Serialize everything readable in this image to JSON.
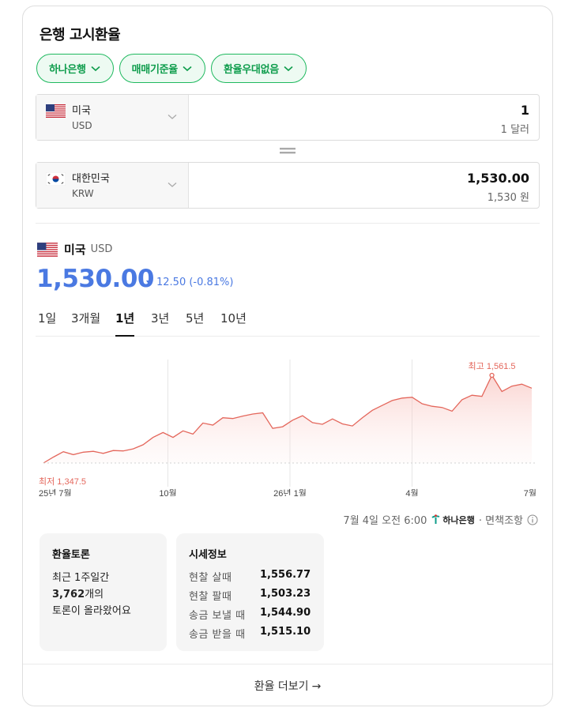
{
  "title": "은행 고시환율",
  "filters": [
    "하나은행",
    "매매기준율",
    "환율우대없음"
  ],
  "from": {
    "country": "미국",
    "code": "USD",
    "amount": "1",
    "amount_text": "1 달러"
  },
  "to": {
    "country": "대한민국",
    "code": "KRW",
    "amount": "1,530.00",
    "amount_text": "1,530 원"
  },
  "rate": {
    "country": "미국",
    "code": "USD",
    "value": "1,530.00",
    "change": "12.50 (-0.81%)"
  },
  "periods": [
    "1일",
    "3개월",
    "1년",
    "3년",
    "5년",
    "10년"
  ],
  "active_period": "1년",
  "chart_data": {
    "type": "area",
    "x_ticks": [
      "25년 7월",
      "10월",
      "26년 1월",
      "4월",
      "7월"
    ],
    "values": [
      1347.5,
      1362,
      1375,
      1368,
      1374,
      1376,
      1371,
      1378,
      1377,
      1382,
      1392,
      1410,
      1422,
      1410,
      1426,
      1418,
      1445,
      1440,
      1458,
      1456,
      1462,
      1467,
      1470,
      1432,
      1436,
      1452,
      1463,
      1446,
      1442,
      1455,
      1443,
      1438,
      1458,
      1476,
      1488,
      1500,
      1506,
      1508,
      1492,
      1486,
      1483,
      1474,
      1502,
      1513,
      1510,
      1561.5,
      1522,
      1535,
      1540,
      1530
    ],
    "max": {
      "label": "최고",
      "value": "1,561.5"
    },
    "min": {
      "label": "최저",
      "value": "1,347.5"
    },
    "line_color": "#e4675c"
  },
  "source": {
    "timestamp": "7월 4일 오전 6:00",
    "bank": "하나은행",
    "disclaimer": "· 면책조항"
  },
  "forum": {
    "title": "환율토론",
    "line1": "최근 1주일간",
    "count": "3,762",
    "count_suffix": "개의",
    "line3": "토론이 올라왔어요"
  },
  "quotes": {
    "title": "시세정보",
    "rows": [
      {
        "label": "현찰 살때",
        "value": "1,556.77"
      },
      {
        "label": "현찰 팔때",
        "value": "1,503.23"
      },
      {
        "label": "송금 보낼 때",
        "value": "1,544.90"
      },
      {
        "label": "송금 받을 때",
        "value": "1,515.10"
      }
    ]
  },
  "more_label": "환율 더보기",
  "colors": {
    "accent_green": "#1fb95f",
    "rate_blue": "#4a79e2",
    "chart_red": "#e4675c"
  }
}
